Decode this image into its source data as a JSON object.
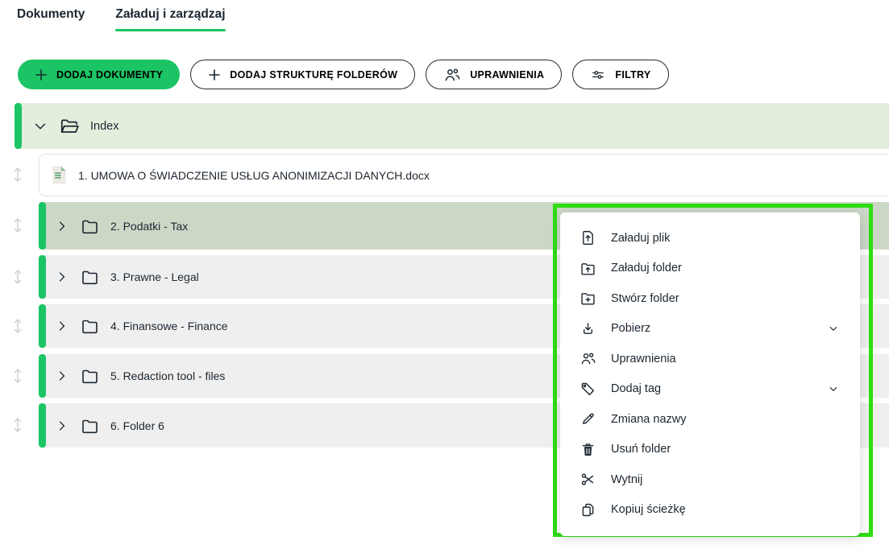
{
  "tabs": [
    {
      "label": "Dokumenty",
      "active": false
    },
    {
      "label": "Załaduj i zarządzaj",
      "active": true
    }
  ],
  "toolbar": {
    "buttons": [
      {
        "label": "DODAJ DOKUMENTY",
        "icon": "plus-icon",
        "primary": true
      },
      {
        "label": "DODAJ STRUKTURĘ FOLDERÓW",
        "icon": "plus-icon",
        "primary": false
      },
      {
        "label": "UPRAWNIENIA",
        "icon": "people-icon",
        "primary": false
      },
      {
        "label": "FILTRY",
        "icon": "filter-sliders-icon",
        "primary": false
      }
    ]
  },
  "tree": {
    "root": {
      "label": "Index",
      "expanded": true
    },
    "document": {
      "label": "1. UMOWA O ŚWIADCZENIE USŁUG ANONIMIZACJI DANYCH.docx"
    },
    "folders": [
      {
        "label": "2. Podatki - Tax",
        "selected": true
      },
      {
        "label": "3. Prawne - Legal",
        "selected": false
      },
      {
        "label": "4. Finansowe - Finance",
        "selected": false
      },
      {
        "label": "5. Redaction tool - files",
        "selected": false
      },
      {
        "label": "6. Folder 6",
        "selected": false
      }
    ]
  },
  "context_menu": {
    "items": [
      {
        "label": "Załaduj plik",
        "icon": "file-upload-icon",
        "submenu": false
      },
      {
        "label": "Załaduj folder",
        "icon": "folder-upload-icon",
        "submenu": false
      },
      {
        "label": "Stwórz folder",
        "icon": "folder-plus-icon",
        "submenu": false
      },
      {
        "label": "Pobierz",
        "icon": "download-icon",
        "submenu": true
      },
      {
        "label": "Uprawnienia",
        "icon": "people-icon",
        "submenu": false
      },
      {
        "label": "Dodaj tag",
        "icon": "tag-icon",
        "submenu": true
      },
      {
        "label": "Zmiana nazwy",
        "icon": "pencil-icon",
        "submenu": false
      },
      {
        "label": "Usuń folder",
        "icon": "trash-icon",
        "submenu": false
      },
      {
        "label": "Wytnij",
        "icon": "scissors-icon",
        "submenu": false
      },
      {
        "label": "Kopiuj ścieżkę",
        "icon": "copy-icon",
        "submenu": false
      }
    ]
  },
  "colors": {
    "accent-green": "#1bc464",
    "annotation-green": "#2edd12",
    "index-bg": "#e3eedd",
    "selected-bg": "#ccd8c6",
    "row-bg": "#efefef",
    "text": "#1b2630"
  }
}
